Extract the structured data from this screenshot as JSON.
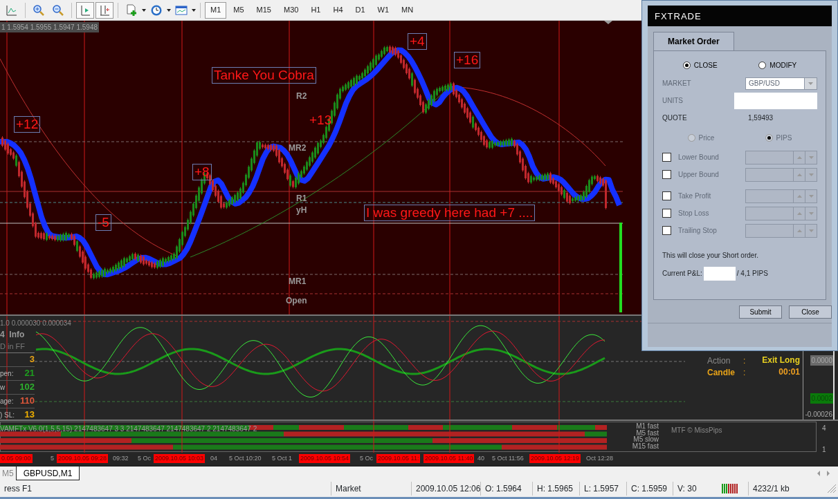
{
  "toolbar": {
    "timeframes": [
      {
        "label": "M1",
        "selected": true
      },
      {
        "label": "M5",
        "selected": false
      },
      {
        "label": "M15",
        "selected": false
      },
      {
        "label": "M30",
        "selected": false
      },
      {
        "label": "H1",
        "selected": false
      },
      {
        "label": "H4",
        "selected": false
      },
      {
        "label": "D1",
        "selected": false
      },
      {
        "label": "W1",
        "selected": false
      },
      {
        "label": "MN",
        "selected": false
      }
    ]
  },
  "chart": {
    "ohlc_header": "1 1.5954 1.5955 1.5947 1.5948",
    "annotations": [
      {
        "text": "Tanke You Cobra",
        "boxed": true
      },
      {
        "text": "+4",
        "boxed": true
      },
      {
        "text": "+16",
        "boxed": true
      },
      {
        "text": "+12",
        "boxed": true
      },
      {
        "text": "+13",
        "boxed": false
      },
      {
        "text": "+8",
        "boxed": true
      },
      {
        "text": "-5",
        "boxed": true
      },
      {
        "text": "I was greedy here had +7 ....",
        "boxed": true
      }
    ],
    "levels": [
      "R2",
      "MR2",
      "R1",
      "yH",
      "MR1",
      "Open"
    ]
  },
  "indicator": {
    "header": "1.0 0.000030 0.000034",
    "info_title": "4  Info",
    "info_subtitle": "D in FF",
    "info_rows": [
      {
        "value": "3",
        "color": "#e8a317"
      },
      {
        "label": "pen:",
        "value": "21",
        "color": "#1e9e1e"
      },
      {
        "label": "w",
        "value": "102",
        "color": "#2db02d"
      },
      {
        "label": "age:",
        "value": "110",
        "color": "#e0583a"
      },
      {
        "label": ") SL:",
        "value": "13",
        "color": "#f0b000"
      }
    ],
    "signal": [
      {
        "label": "Action",
        "sep": ":",
        "value": "Exit Long",
        "color": "#8c8c8c"
      },
      {
        "label": "Candle",
        "sep": ":",
        "value": "00:01",
        "color": "#e8a317"
      }
    ],
    "scale": [
      {
        "label": "0.0000",
        "kind": "value_tag"
      },
      {
        "label": "0.0002",
        "kind": "signal_tag"
      },
      {
        "label": "-0.00026",
        "kind": "tick"
      }
    ]
  },
  "mtf": {
    "header": "VAMFTx V6.0(1,5,5,15) 2147483647 3 3 2147483647 2147483647 2 2147483647 2",
    "rows": [
      "M1 fast",
      "M5 fast",
      "M5 slow",
      "M15 fast"
    ],
    "credit": "MTF © MissPips",
    "scale": [
      "4",
      "1"
    ]
  },
  "time_axis": [
    {
      "label": "0.05 09:00",
      "kind": "marker"
    },
    {
      "label": "5",
      "kind": "tick"
    },
    {
      "label": "2009.10.05 09:28",
      "kind": "marker"
    },
    {
      "label": "09:32",
      "kind": "tick"
    },
    {
      "label": "5 Oc",
      "kind": "tick"
    },
    {
      "label": "2009.10.05 10:03",
      "kind": "marker"
    },
    {
      "label": "04",
      "kind": "tick"
    },
    {
      "label": "5 Oct 10:20",
      "kind": "tick"
    },
    {
      "label": "5 Oct 1",
      "kind": "tick"
    },
    {
      "label": "2009.10.05 10:54",
      "kind": "marker"
    },
    {
      "label": "5 Oc",
      "kind": "tick"
    },
    {
      "label": "2009.10.05 11:",
      "kind": "marker"
    },
    {
      "label": "2009.10.05 11:40",
      "kind": "marker"
    },
    {
      "label": "40",
      "kind": "tick"
    },
    {
      "label": "5 Oct 11:56",
      "kind": "tick"
    },
    {
      "label": "2009.10.05 12:19",
      "kind": "marker"
    },
    {
      "label": "Oct 12:28",
      "kind": "tick"
    }
  ],
  "chart_tabs": [
    {
      "label": "M5",
      "selected": false
    },
    {
      "label": "GBPUSD,M1",
      "selected": true
    }
  ],
  "status_bar": [
    "ress F1",
    "Market",
    "2009.10.05 12:06",
    "O: 1.5964",
    "H: 1.5965",
    "L: 1.5957",
    "C: 1.5959",
    "V: 30",
    "4232/1 kb"
  ],
  "dialog": {
    "logo": "FXTRADE",
    "tab": "Market Order",
    "mode_options": [
      {
        "label": "CLOSE",
        "selected": true
      },
      {
        "label": "MODIFY",
        "selected": false
      }
    ],
    "fields": [
      {
        "label": "MARKET",
        "kind": "select",
        "value": "GBP/USD",
        "disabled": true
      },
      {
        "label": "UNITS",
        "kind": "input",
        "disabled": true
      },
      {
        "label": "QUOTE",
        "kind": "readout",
        "value": "1,59493",
        "disabled": false
      }
    ],
    "unit_options": [
      {
        "label": "Price",
        "selected": false,
        "disabled": true
      },
      {
        "label": "PIPS",
        "selected": true,
        "disabled": true
      }
    ],
    "bounds": [
      {
        "label": "Lower Bound",
        "checked": false,
        "disabled": true
      },
      {
        "label": "Upper Bound",
        "checked": false,
        "disabled": true
      },
      {
        "label": "Take Profit",
        "checked": false,
        "disabled": true
      },
      {
        "label": "Stop Loss",
        "checked": false,
        "disabled": true
      },
      {
        "label": "Trailing Stop",
        "checked": false,
        "disabled": true
      }
    ],
    "message": "This will close your Short order.",
    "pnl": {
      "label": "Current P&L:",
      "value": "/ 4,1 PIPS"
    },
    "buttons": [
      "Submit",
      "Close"
    ]
  }
}
